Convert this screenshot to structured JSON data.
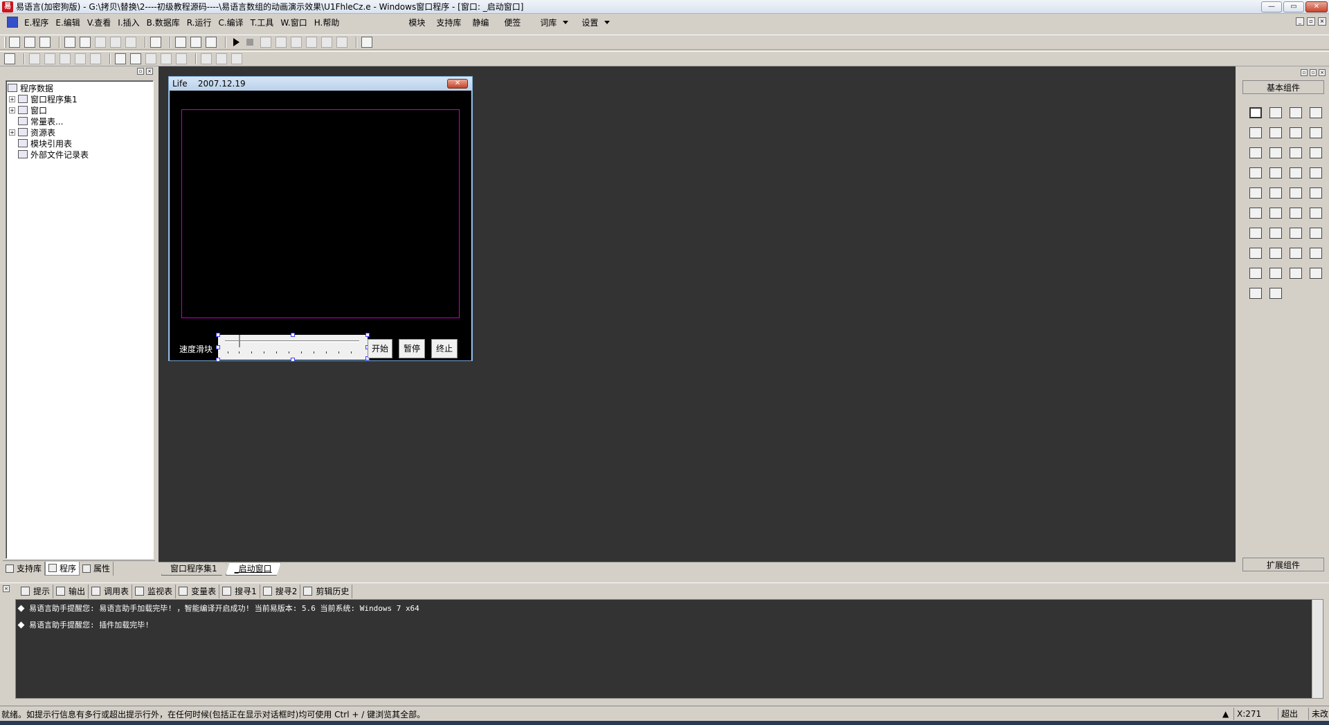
{
  "window": {
    "title": "易语言(加密狗版) - G:\\拷贝\\替换\\2----初级教程源码----\\易语言数组的动画演示效果\\U1FhleCz.e - Windows窗口程序 - [窗口: _启动窗口]",
    "minimize": "—",
    "maximize": "▭",
    "close": "✕"
  },
  "menu": {
    "items": [
      "E.程序",
      "E.编辑",
      "V.查看",
      "I.插入",
      "B.数据库",
      "R.运行",
      "C.编译",
      "T.工具",
      "W.窗口",
      "H.帮助"
    ],
    "extra": [
      "模块",
      "支持库",
      "静编",
      "便签",
      "词库",
      "设置"
    ]
  },
  "left_panel": {
    "tree": [
      {
        "label": "程序数据",
        "level": 0,
        "expander": ""
      },
      {
        "label": "窗口程序集1",
        "level": 1,
        "expander": "+"
      },
      {
        "label": "窗口",
        "level": 1,
        "expander": "+"
      },
      {
        "label": "常量表...",
        "level": 1,
        "expander": ""
      },
      {
        "label": "资源表",
        "level": 1,
        "expander": "+"
      },
      {
        "label": "模块引用表",
        "level": 1,
        "expander": ""
      },
      {
        "label": "外部文件记录表",
        "level": 1,
        "expander": ""
      }
    ],
    "tabs": [
      "支持库",
      "程序",
      "属性"
    ]
  },
  "form": {
    "title": "Life    2007.12.19",
    "close": "✕",
    "speed_label": "速度滑块",
    "buttons": {
      "start": "开始",
      "pause": "暂停",
      "stop": "终止"
    },
    "border_color": "#c800c8"
  },
  "doc_tabs": [
    "窗口程序集1",
    "_启动窗口"
  ],
  "right_panel": {
    "header": "基本组件",
    "footer": "扩展组件",
    "component_count": 38
  },
  "output": {
    "tabs": [
      "提示",
      "输出",
      "调用表",
      "监视表",
      "变量表",
      "搜寻1",
      "搜寻2",
      "剪辑历史"
    ],
    "lines": [
      "易语言助手提醒您: 易语言助手加载完毕! ，智能编译开启成功! 当前易版本: 5.6 当前系统: Windows 7 x64",
      "易语言助手提醒您: 插件加载完毕!"
    ]
  },
  "status": {
    "text": "就绪。如提示行信息有多行或超出提示行外，在任何时候(包括正在显示对话框时)均可使用 Ctrl + / 键浏览其全部。",
    "coord": "X:271",
    "mode": "超出",
    "state": "未改"
  },
  "colors": {
    "canvas": "#333333",
    "accent": "#c800c8"
  }
}
